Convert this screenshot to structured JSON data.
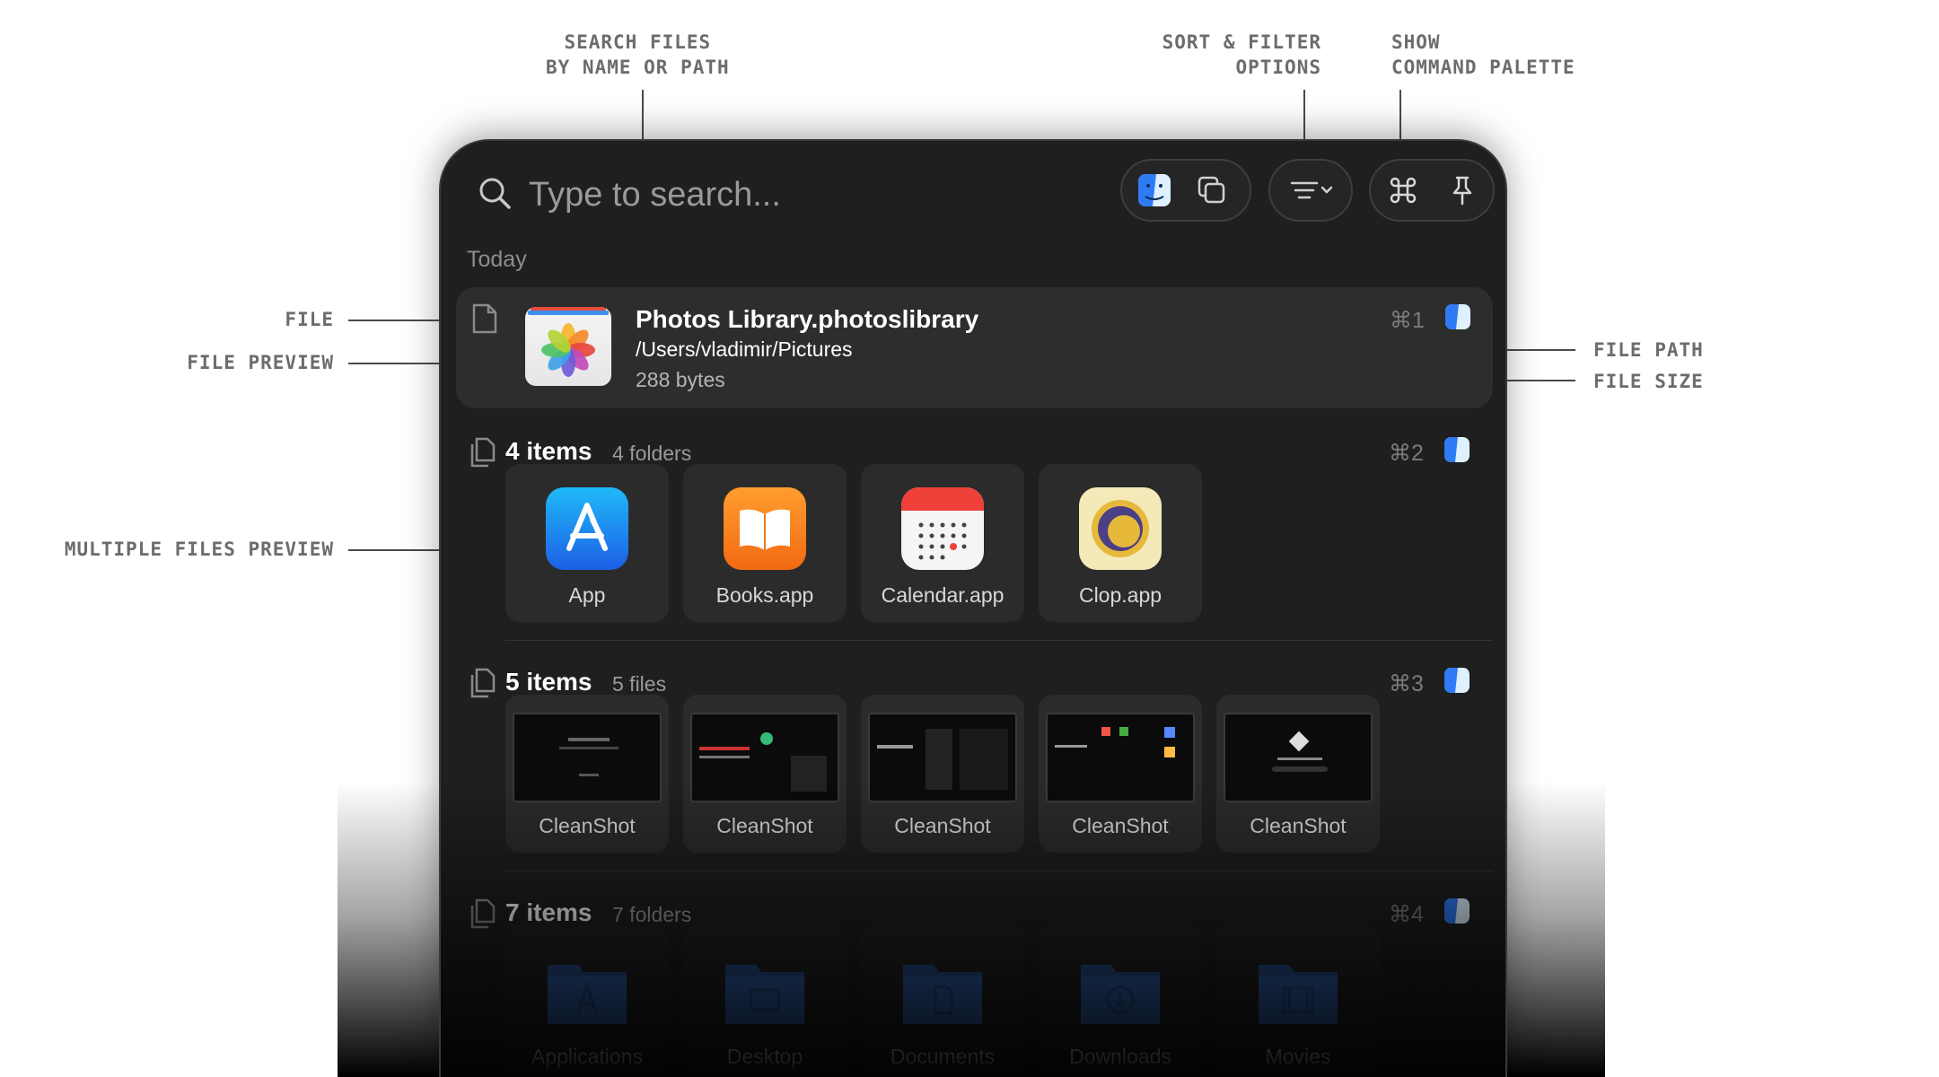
{
  "annotations": {
    "search": "SEARCH FILES\nBY NAME OR PATH",
    "sort_filter": "SORT & FILTER\nOPTIONS",
    "command_palette": "SHOW\nCOMMAND PALETTE",
    "file": "FILE",
    "file_preview": "FILE PREVIEW",
    "file_path": "FILE PATH",
    "file_size": "FILE SIZE",
    "multiple_preview": "MULTIPLE FILES PREVIEW"
  },
  "search": {
    "placeholder": "Type to search..."
  },
  "section": {
    "label": "Today"
  },
  "file_entry": {
    "title": "Photos Library.photoslibrary",
    "path": "/Users/vladimir/Pictures",
    "size": "288 bytes",
    "shortcut": "⌘1"
  },
  "groups": [
    {
      "count": "4 items",
      "sub": "4 folders",
      "shortcut": "⌘2",
      "items": [
        "App",
        "Books.app",
        "Calendar.app",
        "Clop.app"
      ]
    },
    {
      "count": "5 items",
      "sub": "5 files",
      "shortcut": "⌘3",
      "items": [
        "CleanShot",
        "CleanShot",
        "CleanShot",
        "CleanShot",
        "CleanShot"
      ]
    },
    {
      "count": "7 items",
      "sub": "7 folders",
      "shortcut": "⌘4",
      "items": [
        "Applications",
        "Desktop",
        "Documents",
        "Downloads",
        "Movies"
      ]
    }
  ],
  "icons": {
    "search": "search-icon",
    "finder": "finder-icon",
    "copy": "copy-icon",
    "sort": "sort-icon",
    "command": "command-icon",
    "pin": "pin-icon"
  },
  "colors": {
    "panel": "#1f1f1f",
    "accent": "#2f7bf6",
    "folder": "#2a4e8f"
  }
}
